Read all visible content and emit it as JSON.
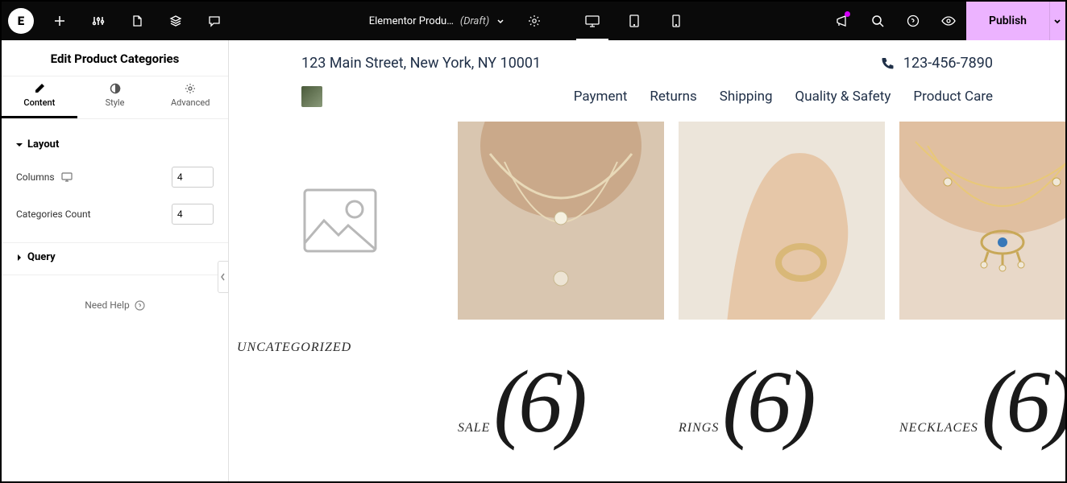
{
  "topbar": {
    "doc_title": "Elementor Produ…",
    "doc_status": "(Draft)",
    "publish_label": "Publish"
  },
  "sidebar": {
    "title": "Edit Product Categories",
    "tabs": {
      "content": "Content",
      "style": "Style",
      "advanced": "Advanced"
    },
    "sections": {
      "layout": "Layout",
      "query": "Query"
    },
    "fields": {
      "columns_label": "Columns",
      "columns_value": "4",
      "count_label": "Categories Count",
      "count_value": "4"
    },
    "help": "Need Help"
  },
  "site": {
    "address": "123 Main Street, New York, NY 10001",
    "phone": "123-456-7890",
    "nav": {
      "payment": "Payment",
      "returns": "Returns",
      "shipping": "Shipping",
      "quality": "Quality & Safety",
      "care": "Product Care"
    }
  },
  "categories": [
    {
      "label": "UNCATEGORIZED",
      "count": ""
    },
    {
      "label": "SALE",
      "count": "(6)"
    },
    {
      "label": "RINGS",
      "count": "(6)"
    },
    {
      "label": "NECKLACES",
      "count": "(6)"
    }
  ]
}
